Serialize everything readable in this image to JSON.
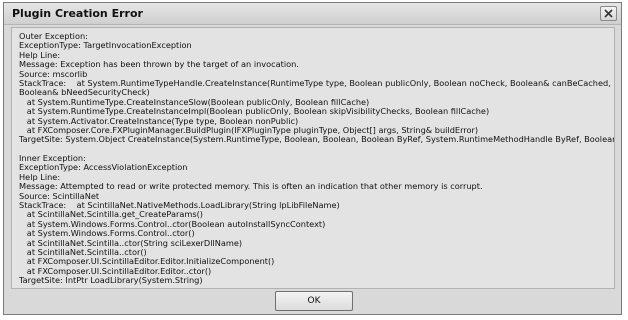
{
  "window": {
    "title": "Plugin Creation Error"
  },
  "message_lines": [
    "Outer Exception:",
    "ExceptionType: TargetInvocationException",
    "Help Line:",
    "Message: Exception has been thrown by the target of an invocation.",
    "Source: mscorlib",
    "StackTrace:    at System.RuntimeTypeHandle.CreateInstance(RuntimeType type, Boolean publicOnly, Boolean noCheck, Boolean& canBeCached, RuntimeMethodHandle& ctor,",
    "Boolean& bNeedSecurityCheck)",
    "   at System.RuntimeType.CreateInstanceSlow(Boolean publicOnly, Boolean fillCache)",
    "   at System.RuntimeType.CreateInstanceImpl(Boolean publicOnly, Boolean skipVisibilityChecks, Boolean fillCache)",
    "   at System.Activator.CreateInstance(Type type, Boolean nonPublic)",
    "   at FXComposer.Core.FXPluginManager.BuildPlugin(IFXPluginType pluginType, Object[] args, String& buildError)",
    "TargetSite: System.Object CreateInstance(System.RuntimeType, Boolean, Boolean, Boolean ByRef, System.RuntimeMethodHandle ByRef, Boolean ByRef)",
    "",
    "Inner Exception:",
    "ExceptionType: AccessViolationException",
    "Help Line:",
    "Message: Attempted to read or write protected memory. This is often an indication that other memory is corrupt.",
    "Source: ScintillaNet",
    "StackTrace:    at ScintillaNet.NativeMethods.LoadLibrary(String lpLibFileName)",
    "   at ScintillaNet.Scintilla.get_CreateParams()",
    "   at System.Windows.Forms.Control..ctor(Boolean autoInstallSyncContext)",
    "   at System.Windows.Forms.Control..ctor()",
    "   at ScintillaNet.Scintilla..ctor(String sciLexerDllName)",
    "   at ScintillaNet.Scintilla..ctor()",
    "   at FXComposer.UI.ScintillaEditor.Editor.InitializeComponent()",
    "   at FXComposer.UI.ScintillaEditor.Editor..ctor()",
    "TargetSite: IntPtr LoadLibrary(System.String)"
  ],
  "ok_button": {
    "label": "OK"
  },
  "icons": {
    "close": "close-x-icon"
  }
}
